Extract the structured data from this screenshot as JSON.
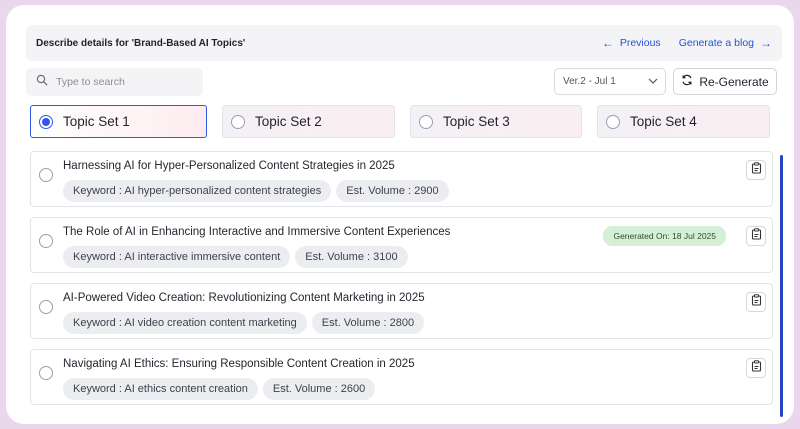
{
  "header": {
    "title": "Describe details for 'Brand-Based AI Topics'",
    "previous_label": "Previous",
    "generate_label": "Generate a blog"
  },
  "search": {
    "placeholder": "Type to search",
    "value": ""
  },
  "version": {
    "selected": "Ver.2 - Jul 1"
  },
  "regenerate_label": "Re-Generate",
  "tabs": [
    {
      "label": "Topic Set 1",
      "selected": true
    },
    {
      "label": "Topic Set 2",
      "selected": false
    },
    {
      "label": "Topic Set 3",
      "selected": false
    },
    {
      "label": "Topic Set 4",
      "selected": false
    }
  ],
  "topics": [
    {
      "title": "Harnessing AI for Hyper-Personalized Content Strategies in 2025",
      "keyword": "Keyword : AI hyper-personalized content strategies",
      "volume": "Est. Volume : 2900",
      "generated": ""
    },
    {
      "title": "The Role of AI in Enhancing Interactive and Immersive Content Experiences",
      "keyword": "Keyword : AI interactive immersive content",
      "volume": "Est. Volume : 3100",
      "generated": "Generated On: 18 Jul 2025"
    },
    {
      "title": "AI-Powered Video Creation: Revolutionizing Content Marketing in 2025",
      "keyword": "Keyword : AI video creation content marketing",
      "volume": "Est. Volume : 2800",
      "generated": ""
    },
    {
      "title": "Navigating AI Ethics: Ensuring Responsible Content Creation in 2025",
      "keyword": "Keyword : AI ethics content creation",
      "volume": "Est. Volume : 2600",
      "generated": ""
    }
  ],
  "colors": {
    "accent": "#2f58e8",
    "badge_bg": "#d6f0d7",
    "frame_bg": "#e9d7ec"
  },
  "icons": {
    "search": "search-icon",
    "chevron": "chevron-down-icon",
    "refresh": "refresh-icon",
    "copy": "copy-icon"
  }
}
